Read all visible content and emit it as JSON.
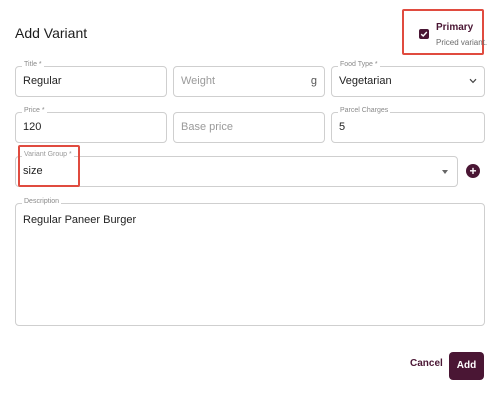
{
  "dialog": {
    "title": "Add Variant"
  },
  "primary": {
    "label": "Primary",
    "description": "Priced variant.",
    "checked": true
  },
  "fields": {
    "title": {
      "label": "Title *",
      "value": "Regular"
    },
    "weight": {
      "placeholder": "Weight",
      "suffix": "g"
    },
    "food_type": {
      "label": "Food Type *",
      "value": "Vegetarian"
    },
    "price": {
      "label": "Price *",
      "value": "120"
    },
    "base_price": {
      "placeholder": "Base price"
    },
    "parcel_charges": {
      "label": "Parcel Charges",
      "value": "5"
    },
    "variant_group": {
      "label": "Variant Group *",
      "value": "size"
    },
    "description": {
      "label": "Description",
      "value": "Regular Paneer Burger"
    }
  },
  "actions": {
    "cancel_label": "Cancel",
    "add_label": "Add"
  },
  "colors": {
    "accent": "#4a1634",
    "highlight": "#e04b3f"
  },
  "icons": {
    "checkbox": "check-icon",
    "food_type_dropdown": "chevron-down-icon",
    "group_dropdown": "caret-down-icon",
    "add_group": "plus-circle-icon"
  }
}
